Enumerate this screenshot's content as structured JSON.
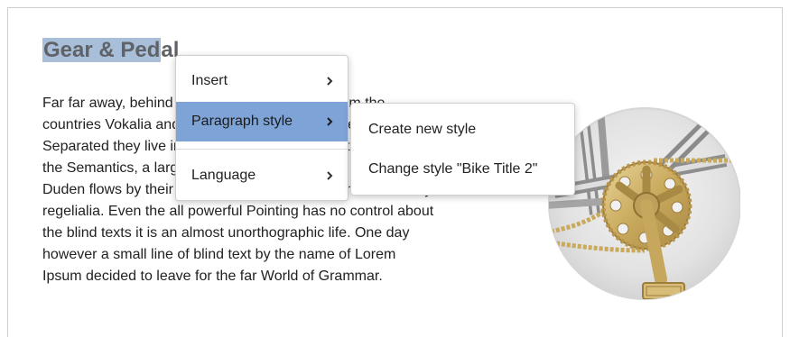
{
  "document": {
    "title_selected": "Gear & Ped",
    "title_rest": "al",
    "body_lines": [
      "Far far away, behind the word mountains, far from the",
      "countries Vokalia and Consonantia, there live the blind texts.",
      "Separated they live in Bookmarksgrove right at the coast of",
      "the Semantics, a large language ocean. A small river named",
      "Duden flows by their place and supplies it with the necessary",
      "regelialia. Even the all powerful Pointing has no control about",
      "the blind texts it is an almost unorthographic life. One day",
      "however a small line of blind text by the name of Lorem",
      "Ipsum decided to leave for the far World of Grammar."
    ]
  },
  "context_menu": {
    "items": [
      {
        "label": "Insert",
        "icon": "chevron-right-icon"
      },
      {
        "label": "Paragraph style",
        "icon": "chevron-right-icon",
        "active": true
      },
      {
        "label": "Language",
        "icon": "chevron-right-icon"
      }
    ]
  },
  "submenu": {
    "items": [
      {
        "label": "Create new style"
      },
      {
        "label": "Change style \"Bike Title 2\""
      }
    ]
  },
  "colors": {
    "highlight": "#7ea3d6",
    "title_selection": "#a9bfd9",
    "title_text": "#5f6368"
  }
}
